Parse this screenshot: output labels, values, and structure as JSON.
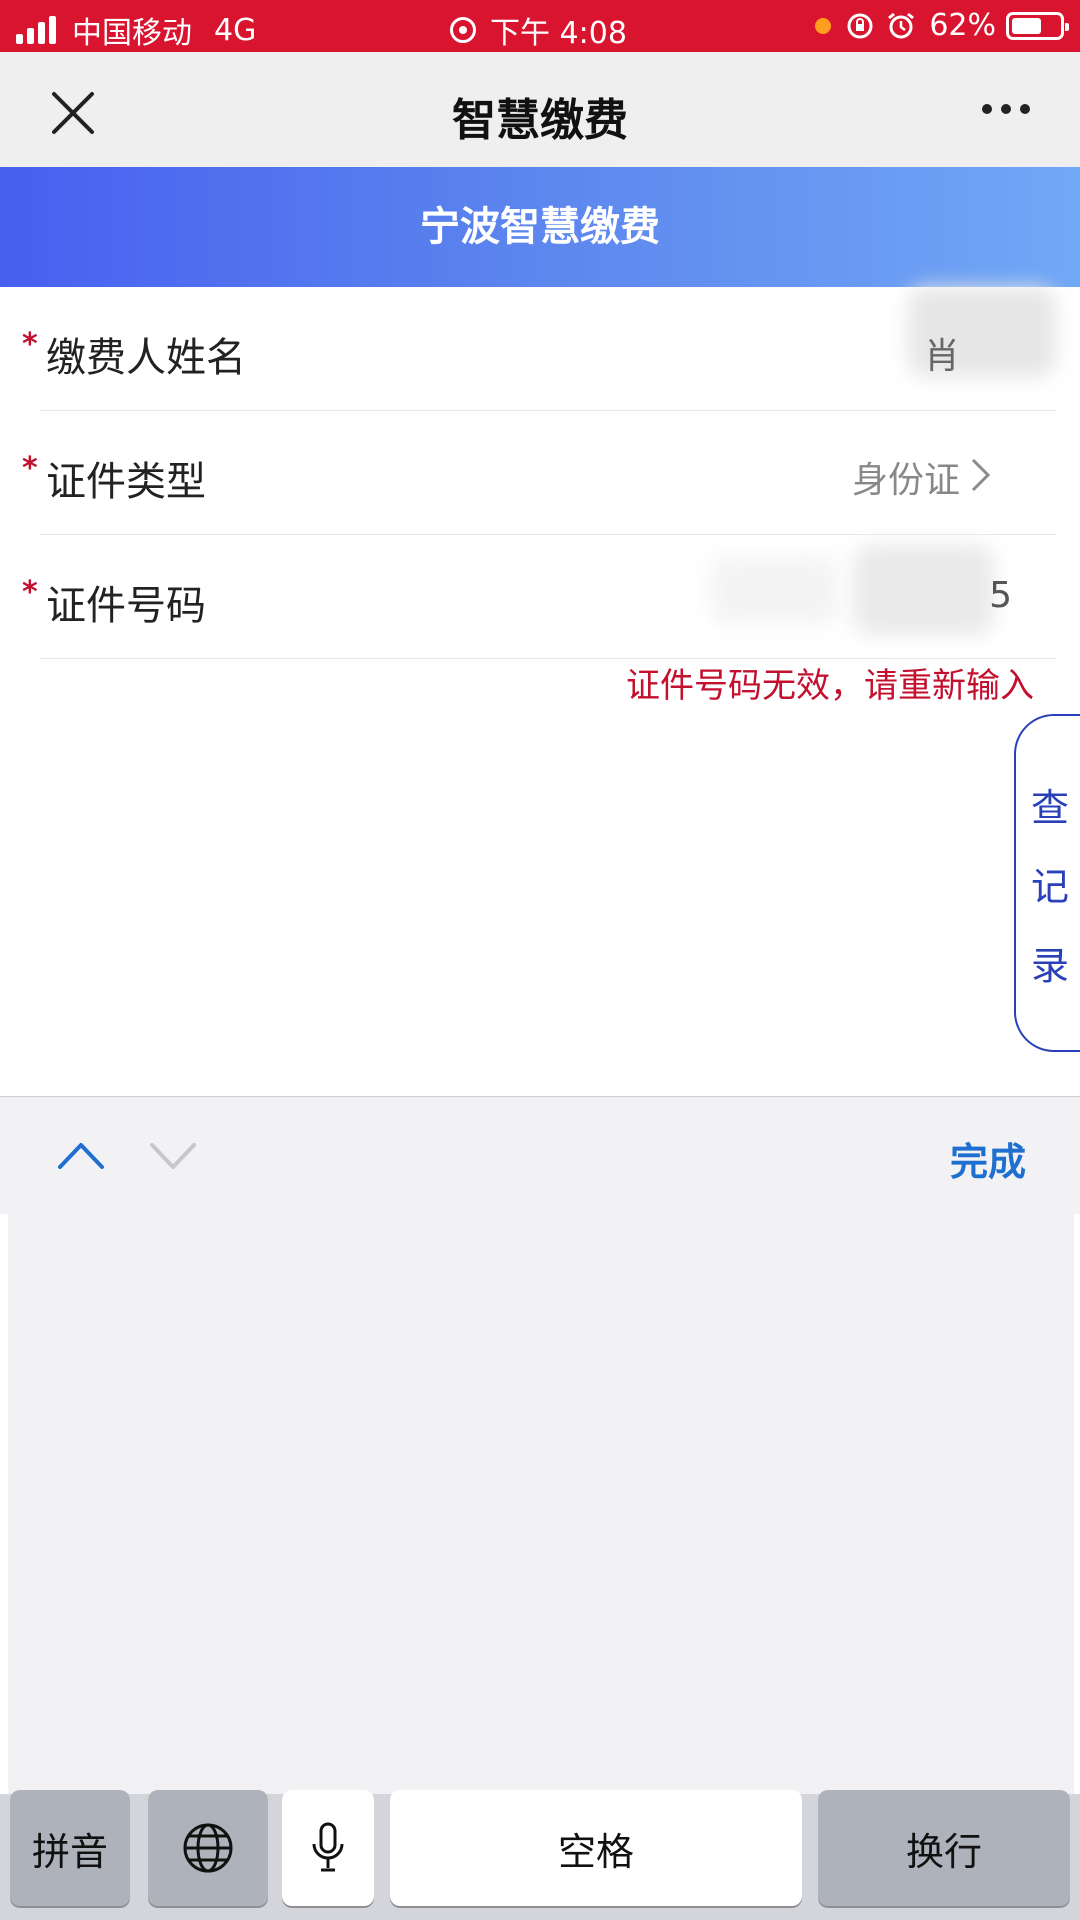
{
  "status_bar": {
    "carrier": "中国移动",
    "network": "4G",
    "time": "下午 4:08",
    "battery": "62%",
    "battery_level": 0.62
  },
  "nav": {
    "title": "智慧缴费",
    "close_icon": "close-icon",
    "more_icon": "more-icon"
  },
  "banner": {
    "title": "宁波智慧缴费"
  },
  "form": {
    "required_mark": "*",
    "fields": [
      {
        "label": "缴费人姓名",
        "value": ""
      },
      {
        "label": "证件类型",
        "value": "身份证"
      },
      {
        "label": "证件号码",
        "value": "5"
      }
    ],
    "error": "证件号码无效，请重新输入"
  },
  "side_tab": {
    "chars": [
      "查",
      "记",
      "录"
    ]
  },
  "keyboard": {
    "done": "完成",
    "keys": {
      "pinyin": "拼音",
      "globe_icon": "globe-icon",
      "mic_icon": "microphone-icon",
      "space": "空格",
      "return": "换行"
    }
  },
  "colors": {
    "status_bar": "#d8142f",
    "banner_start": "#4760f0",
    "banner_end": "#70a8f6",
    "error": "#c3102f",
    "accent": "#1f6fd0"
  }
}
